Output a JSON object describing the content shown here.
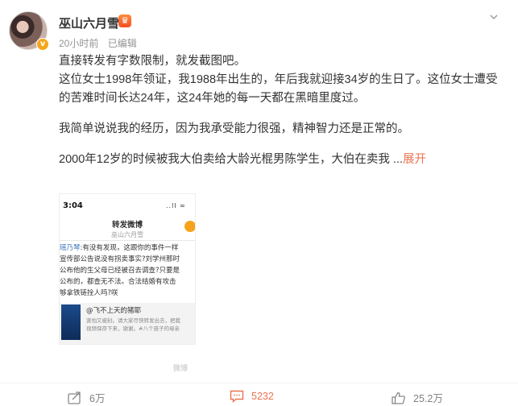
{
  "user": {
    "name": "巫山六月雪",
    "verified_badge": "v",
    "member_icon": "♛"
  },
  "meta": {
    "time": "20小时前",
    "edited": "已编辑"
  },
  "post": {
    "line1": "直接转发有字数限制，就发截图吧。",
    "line2": "这位女士1998年领证，我1988年出生的，年后我就迎接34岁的生日了。这位女士遭受的苦难时间长达24年，这24年她的每一天都在黑暗里度过。",
    "line3": "我简单说说我的经历，因为我承受能力很强，精神智力还是正常的。",
    "line4": "2000年12岁的时候被我大伯卖给大龄光棍男陈学生，大伯在卖我 ...",
    "expand_label": "展开"
  },
  "embed": {
    "time": "3:04",
    "signal": "..ll ≈",
    "title": "转发微博",
    "subtitle": "巫山六月雪",
    "mention": "瑶乃琴",
    "body_lines": [
      ":有没有发现，这跟你的事件一样",
      "宣传部公告说没有拐卖事实?刘学州那时",
      "公布他的生父母已经被召去调查?只要是",
      "公布的，都查无不法。合法结婚有攻击",
      "够拿铁链拴人吗?咲"
    ],
    "quote_title": "@飞不上天的猪耶",
    "quote_lines": [
      "害怕又被封。请大家尽快转发出去，把我",
      "视频保存下来，谢谢。#八个孩子的母亲"
    ]
  },
  "watermark": "微博",
  "actions": {
    "repost_count": "6万",
    "comment_count": "5232",
    "like_count": "25.2万"
  },
  "colors": {
    "accent": "#eb7350",
    "badge": "#f6a61b",
    "text": "#333333",
    "muted": "#939393"
  }
}
